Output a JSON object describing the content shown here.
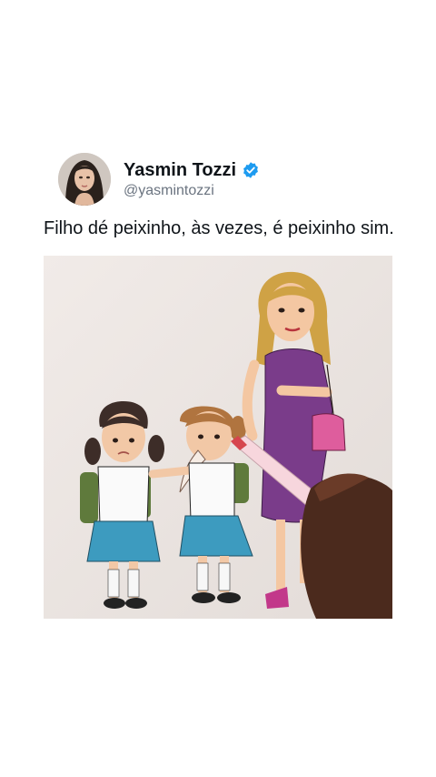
{
  "tweet": {
    "author": {
      "display_name": "Yasmin Tozzi",
      "handle": "@yasmintozzi",
      "verified": true,
      "verified_icon": "verified-badge-icon",
      "verified_color": "#1d9bf0"
    },
    "text": "Filho dé peixinho, às vezes, é peixinho sim.",
    "media": {
      "type": "illustration",
      "subject_icons": [
        "sad-girl",
        "lying-girl",
        "mother",
        "marker-pen",
        "hand"
      ]
    }
  }
}
